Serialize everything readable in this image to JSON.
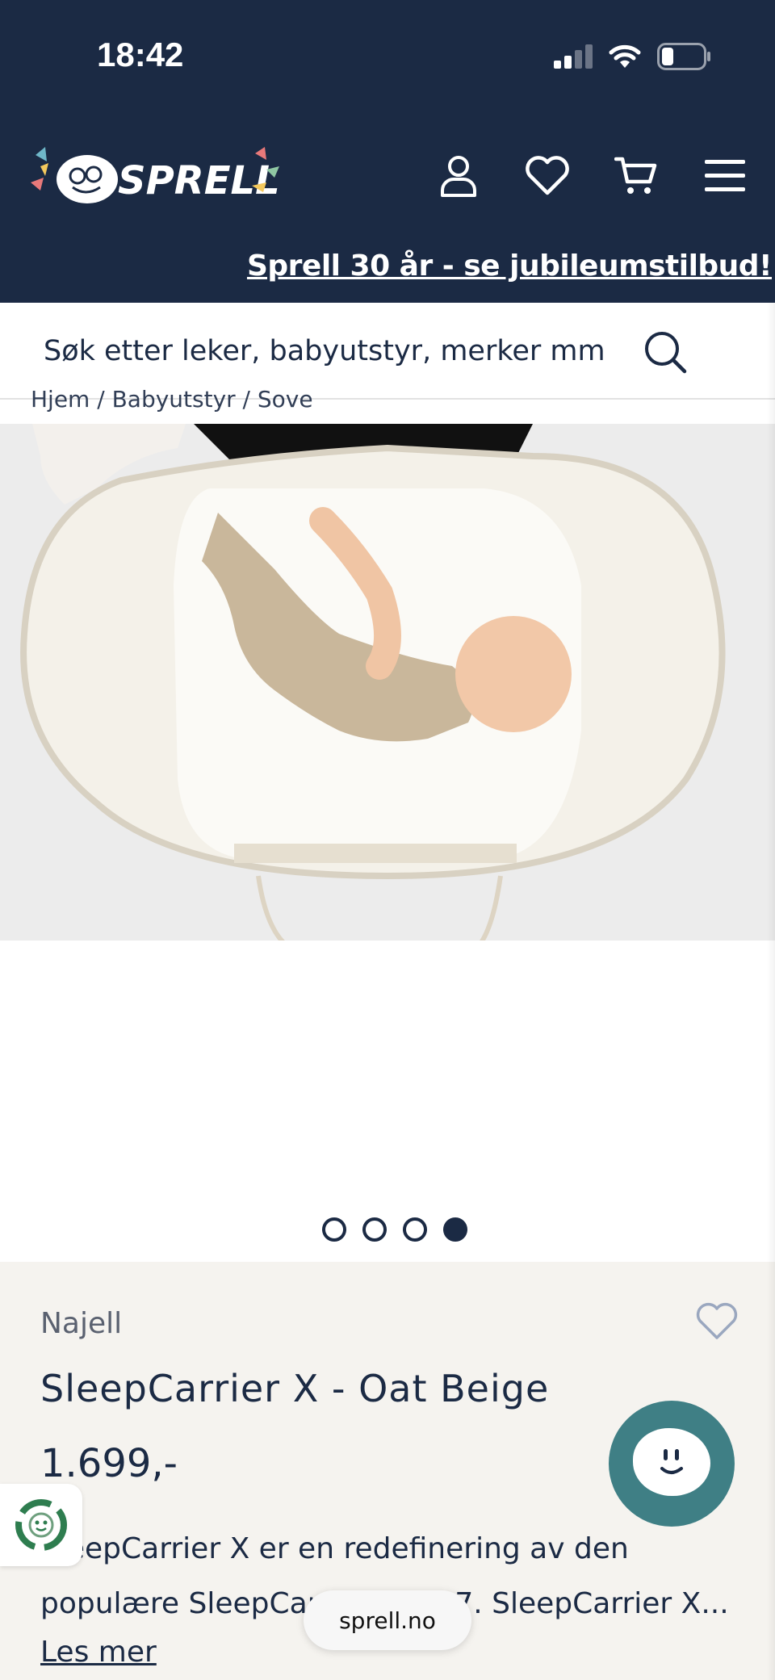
{
  "status_bar": {
    "time": "18:42",
    "icons": [
      "signal-icon",
      "wifi-icon",
      "battery-icon"
    ]
  },
  "header": {
    "logo_text": "SPRELL",
    "icons": [
      "user-icon",
      "heart-icon",
      "cart-icon",
      "menu-icon"
    ]
  },
  "promo": {
    "text": "Sprell 30 år - se jubileumstilbud!"
  },
  "search": {
    "placeholder": "Søk etter leker, babyutstyr, merker mm"
  },
  "breadcrumb": {
    "text": "Hjem  /  Babyutstyr  /  Sove"
  },
  "gallery": {
    "image_alt": "Baby lying on SleepCarrier X",
    "slides": 4,
    "active_slide": 4
  },
  "product": {
    "brand": "Najell",
    "title": "SleepCarrier X - Oat Beige",
    "price": "1.699,-",
    "description_line1": "SleepCarrier X er en redefinering av den",
    "description_line2": "populære SleepCarrier Lush 7. SleepCarrier X...",
    "read_more": "Les mer"
  },
  "browser": {
    "url": "sprell.no"
  },
  "colors": {
    "navy": "#1b2a44",
    "panel": "#f5f3ef",
    "chat": "#3f7f85",
    "eco_green": "#2e7d4f"
  }
}
